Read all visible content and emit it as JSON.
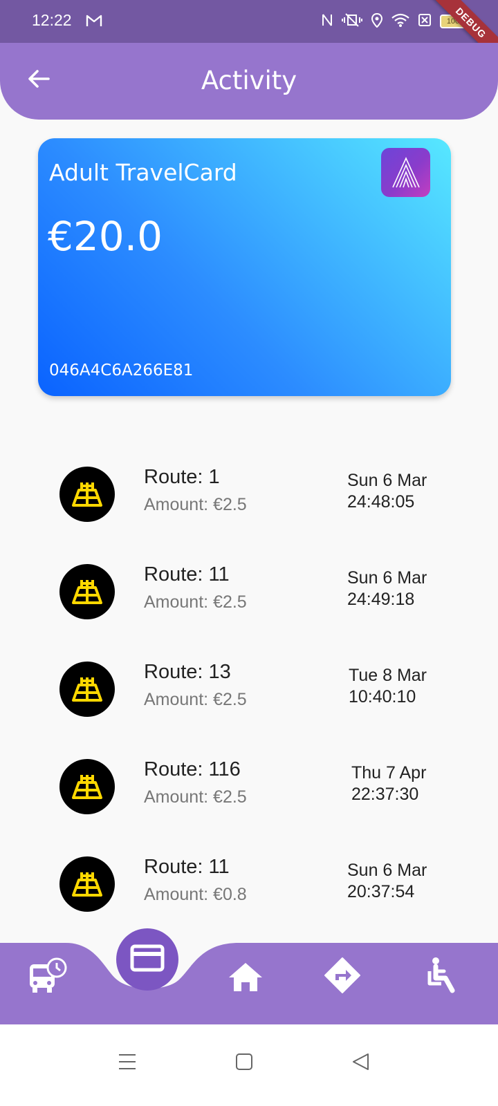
{
  "status_bar": {
    "time": "12:22",
    "icons": [
      "gmail-icon",
      "nfc-icon",
      "vibrate-icon",
      "location-icon",
      "wifi-icon",
      "no-sim-icon",
      "battery-icon"
    ],
    "battery": "100",
    "debug_banner": "DEBUG"
  },
  "header": {
    "title": "Activity",
    "back_icon": "arrow-left-icon"
  },
  "card": {
    "name": "Adult TravelCard",
    "balance": "€20.0",
    "number": "046A4C6A266E81",
    "logo_icon": "leap-a-logo-icon"
  },
  "activity": [
    {
      "route": "Route: 1",
      "amount": "Amount: €2.5",
      "date": "Sun 6 Mar",
      "time": "24:48:05"
    },
    {
      "route": "Route: 11",
      "amount": "Amount: €2.5",
      "date": "Sun 6 Mar",
      "time": "24:49:18"
    },
    {
      "route": "Route: 13",
      "amount": "Amount: €2.5",
      "date": "Tue 8 Mar",
      "time": "10:40:10"
    },
    {
      "route": "Route: 116",
      "amount": "Amount: €2.5",
      "date": "Thu 7 Apr",
      "time": "22:37:30"
    },
    {
      "route": "Route: 11",
      "amount": "Amount: €0.8",
      "date": "Sun 6 Mar",
      "time": "20:37:54"
    }
  ],
  "bottom_nav": {
    "items": [
      "bus-schedule-icon",
      "card-icon",
      "home-icon",
      "directions-icon",
      "accessibility-icon"
    ],
    "active": "card-icon"
  },
  "colors": {
    "status_bar": "#7358a2",
    "app_bar": "#9675cd",
    "fab": "#7c56c2",
    "operator_logo_bg": "#000000",
    "operator_logo_fg": "#ffd800"
  }
}
